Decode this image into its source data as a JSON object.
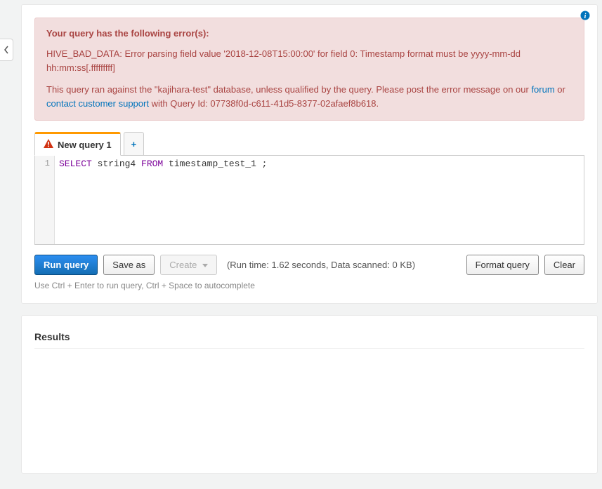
{
  "alert": {
    "title": "Your query has the following error(s):",
    "error_text": "HIVE_BAD_DATA: Error parsing field value '2018-12-08T15:00:00' for field 0: Timestamp format must be yyyy-mm-dd hh:mm:ss[.fffffffff]",
    "ran_against_pre": "This query ran against the \"kajihara-test\" database, unless qualified by the query. Please post the error message on our ",
    "forum_link": "forum",
    "ran_against_mid": " or ",
    "support_link": "contact customer support",
    "ran_against_post": " with Query Id: 07738f0d-c611-41d5-8377-02afaef8b618."
  },
  "tabs": {
    "active_label": "New query 1"
  },
  "editor": {
    "gutter_line": "1",
    "code_keyword1": "SELECT",
    "code_text1": " string4 ",
    "code_keyword2": "FROM",
    "code_text2": " timestamp_test_1 ;"
  },
  "buttons": {
    "run": "Run query",
    "save_as": "Save as",
    "create": "Create",
    "format": "Format query",
    "clear": "Clear"
  },
  "runinfo": "(Run time: 1.62 seconds, Data scanned: 0 KB)",
  "hint": "Use Ctrl + Enter to run query, Ctrl + Space to autocomplete",
  "results": {
    "title": "Results"
  }
}
